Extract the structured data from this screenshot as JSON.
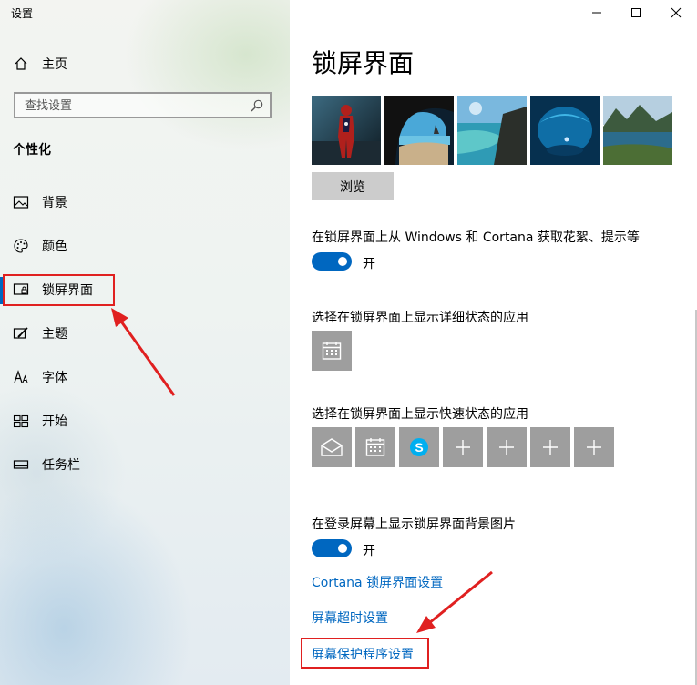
{
  "window": {
    "app_title": "设置",
    "minimize_label": "—",
    "maximize_label": "☐",
    "close_label": "✕"
  },
  "sidebar": {
    "home_label": "主页",
    "search_placeholder": "查找设置",
    "section_heading": "个性化",
    "items": [
      {
        "label": "背景",
        "icon": "picture-icon"
      },
      {
        "label": "颜色",
        "icon": "palette-icon"
      },
      {
        "label": "锁屏界面",
        "icon": "lock-screen-icon",
        "selected": true
      },
      {
        "label": "主题",
        "icon": "theme-brush-icon"
      },
      {
        "label": "字体",
        "icon": "font-icon"
      },
      {
        "label": "开始",
        "icon": "start-tiles-icon"
      },
      {
        "label": "任务栏",
        "icon": "taskbar-icon"
      }
    ]
  },
  "main": {
    "page_title": "锁屏界面",
    "pictures": [
      "spider-man",
      "cave-beach",
      "ocean-cliff",
      "underwater-cave",
      "mountain-lake"
    ],
    "browse_label": "浏览",
    "fun_facts": {
      "label": "在锁屏界面上从 Windows 和 Cortana 获取花絮、提示等",
      "state": "开",
      "on": true
    },
    "detailed_status": {
      "label": "选择在锁屏界面上显示详细状态的应用",
      "apps": [
        "calendar-icon"
      ]
    },
    "quick_status": {
      "label": "选择在锁屏界面上显示快速状态的应用",
      "apps": [
        "mail-icon",
        "calendar-icon",
        "skype-icon",
        "plus-icon",
        "plus-icon",
        "plus-icon",
        "plus-icon"
      ]
    },
    "signin_background": {
      "label": "在登录屏幕上显示锁屏界面背景图片",
      "state": "开",
      "on": true
    },
    "links": {
      "cortana": "Cortana 锁屏界面设置",
      "timeout": "屏幕超时设置",
      "screensaver": "屏幕保护程序设置"
    }
  },
  "colors": {
    "accent": "#0067c0",
    "annotation": "#e02020",
    "tile": "#9e9e9e"
  }
}
